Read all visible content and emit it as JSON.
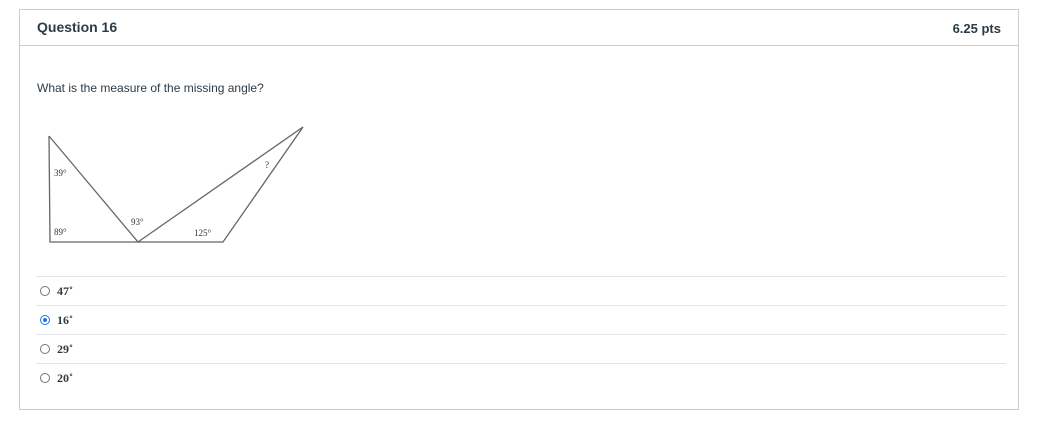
{
  "question": {
    "title": "Question 16",
    "points": "6.25 pts",
    "text": "What is the measure of the missing angle?"
  },
  "figure": {
    "angle_labels": [
      "39°",
      "89°",
      "93°",
      "125°",
      "?"
    ]
  },
  "answers": [
    {
      "label": "47˚",
      "selected": false
    },
    {
      "label": "16˚",
      "selected": true
    },
    {
      "label": "29˚",
      "selected": false
    },
    {
      "label": "20˚",
      "selected": false
    }
  ]
}
